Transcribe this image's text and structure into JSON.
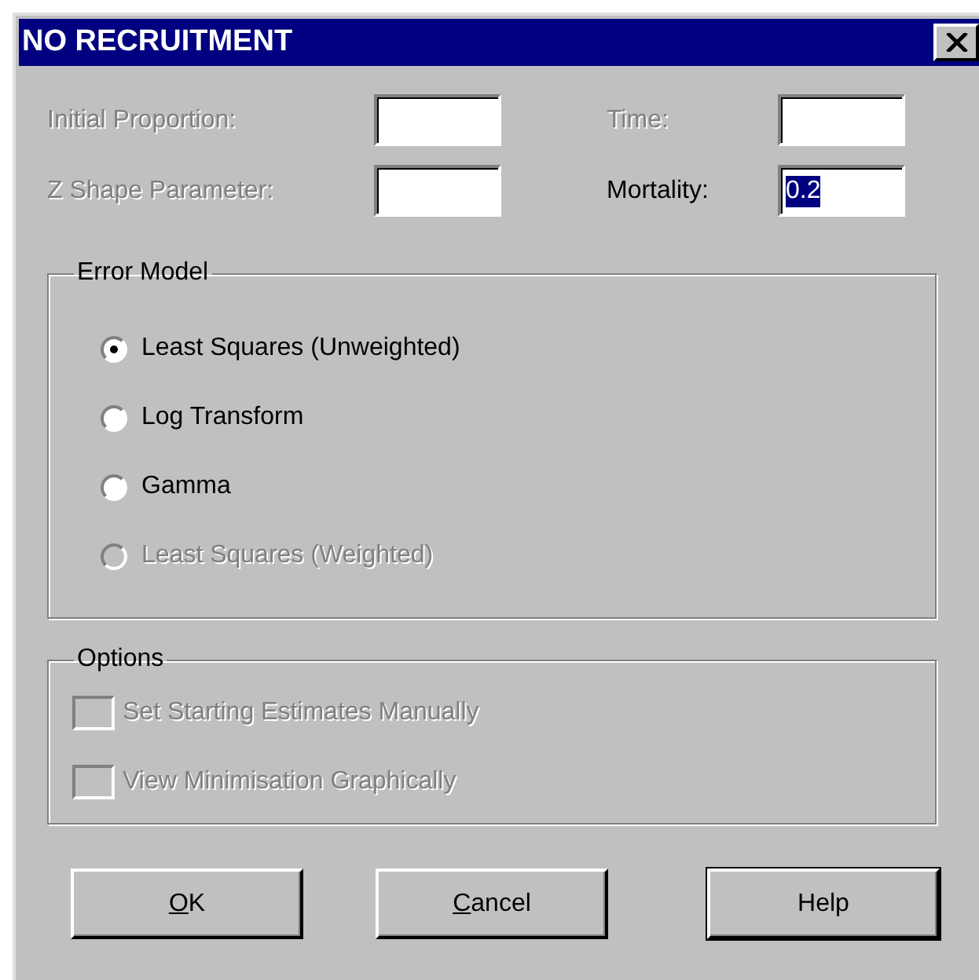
{
  "window": {
    "title": "NO RECRUITMENT"
  },
  "fields": [
    {
      "label": "Initial Proportion:",
      "disabled": true
    },
    {
      "label": "Time:",
      "disabled": true
    },
    {
      "label": "Z Shape Parameter:",
      "disabled": true
    },
    {
      "label": "Mortality:",
      "value": "0.2",
      "disabled": false,
      "selected": true
    }
  ],
  "error_model": {
    "title": "Error Model",
    "options": [
      {
        "label": "Least Squares (Unweighted)",
        "selected": true,
        "disabled": false
      },
      {
        "label": "Log Transform",
        "selected": false,
        "disabled": false
      },
      {
        "label": "Gamma",
        "selected": false,
        "disabled": false
      },
      {
        "label": "Least Squares (Weighted)",
        "selected": false,
        "disabled": true
      }
    ]
  },
  "options": {
    "title": "Options",
    "items": [
      {
        "label": "Set Starting Estimates Manually",
        "checked": false,
        "disabled": true
      },
      {
        "label": "View Minimisation Graphically",
        "checked": false,
        "disabled": true
      }
    ]
  },
  "buttons": [
    {
      "label": "OK",
      "underline_first": true,
      "default": false
    },
    {
      "label": "Cancel",
      "underline_first": true,
      "default": false
    },
    {
      "label": "Help",
      "underline_first": false,
      "default": true
    }
  ]
}
